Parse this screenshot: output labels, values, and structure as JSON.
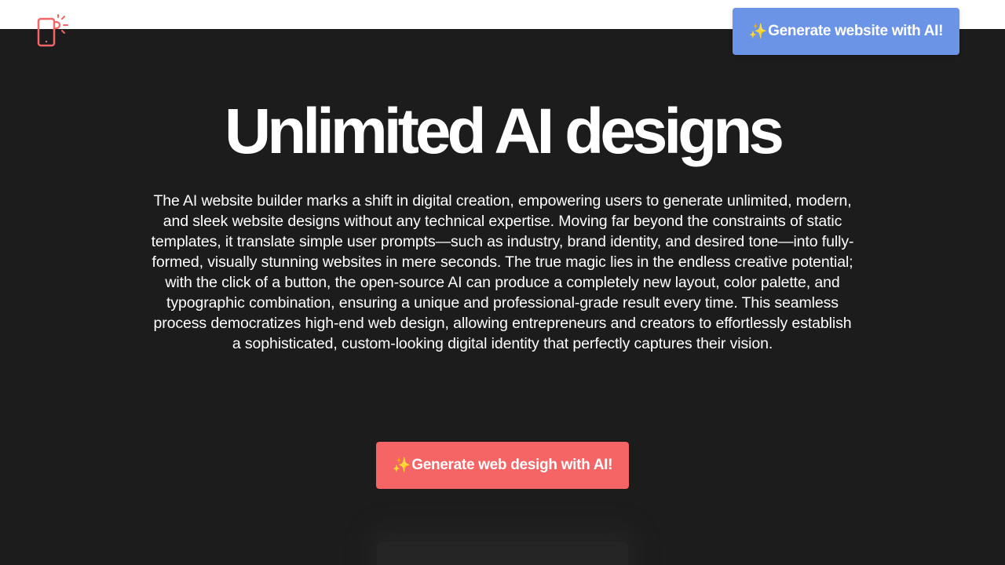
{
  "header": {
    "logo_icon": "phone-sparkle-icon",
    "cta_label": "Generate website with AI!",
    "cta_emoji": "✨"
  },
  "hero": {
    "title": "Unlimited AI designs",
    "description": "The AI website builder marks a shift in digital creation, empowering users to generate unlimited, modern, and sleek website designs without any technical expertise. Moving far beyond the constraints of static templates, it translate simple user prompts—such as industry, brand identity, and desired tone—into fully-formed, visually stunning websites in mere seconds. The true magic lies in the endless creative potential; with the click of a button, the open-source AI can produce a completely new layout, color palette, and typographic combination, ensuring a unique and professional-grade result every time. This seamless process democratizes high-end web design, allowing entrepreneurs and creators to effortlessly establish a sophisticated, custom-looking digital identity that perfectly captures their vision.",
    "cta_label": "Generate web desigh with AI!",
    "cta_emoji": "✨"
  },
  "colors": {
    "background": "#1c1c1c",
    "header_bg": "#ffffff",
    "nav_cta": "#6b93e6",
    "main_cta": "#f56565",
    "logo": "#f56565"
  }
}
